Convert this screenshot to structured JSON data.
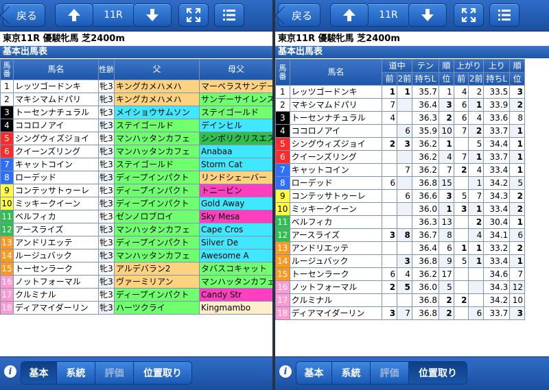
{
  "left": {
    "back_label": "戻る",
    "race_label": "11R",
    "race_title": "東京11R  優駿牝馬  芝2400m",
    "section_title": "基本出馬表",
    "headers": {
      "num": "馬番",
      "name": "馬名",
      "age": "性齢",
      "sire": "父",
      "dam_sire": "母父"
    },
    "rows": [
      {
        "num": "1",
        "name": "レッツゴードンキ",
        "age": "牝3",
        "sire": "キングカメハメハ",
        "dam_sire": "マーベラスサンデー",
        "frame": "#ffffff",
        "ftext": "#000000",
        "sire_color": "#ffd27f",
        "dam_color": "#ffd27f"
      },
      {
        "num": "2",
        "name": "マキシマムドパリ",
        "age": "牝3",
        "sire": "キングカメハメハ",
        "dam_sire": "サンデーサイレンス",
        "frame": "#ffffff",
        "ftext": "#000000",
        "sire_color": "#ffd27f",
        "dam_color": "#6fff6f"
      },
      {
        "num": "3",
        "name": "トーセンナチュラル",
        "age": "牝3",
        "sire": "メイショウサムソン",
        "dam_sire": "ステイゴールド",
        "frame": "#000000",
        "ftext": "#ffffff",
        "sire_color": "#3fe8ff",
        "dam_color": "#6fff6f"
      },
      {
        "num": "4",
        "name": "ココロノアイ",
        "age": "牝3",
        "sire": "ステイゴールド",
        "dam_sire": "デインヒル",
        "frame": "#000000",
        "ftext": "#ffffff",
        "sire_color": "#6fff6f",
        "dam_color": "#3fe8ff"
      },
      {
        "num": "5",
        "name": "シングウィズジョイ",
        "age": "牝3",
        "sire": "マンハッタンカフェ",
        "dam_sire": "シンボリクリスエス",
        "frame": "#ff2a2a",
        "ftext": "#ffffff",
        "sire_color": "#6fff6f",
        "dam_color": "#2fbf4f"
      },
      {
        "num": "6",
        "name": "クイーンズリング",
        "age": "牝3",
        "sire": "マンハッタンカフェ",
        "dam_sire": "Anabaa",
        "frame": "#ff2a2a",
        "ftext": "#ffffff",
        "sire_color": "#6fff6f",
        "dam_color": "#3fe8ff"
      },
      {
        "num": "7",
        "name": "キャットコイン",
        "age": "牝3",
        "sire": "ステイゴールド",
        "dam_sire": "Storm Cat",
        "frame": "#2f6fff",
        "ftext": "#ffffff",
        "sire_color": "#6fff6f",
        "dam_color": "#3fe8ff"
      },
      {
        "num": "8",
        "name": "ローデッド",
        "age": "牝3",
        "sire": "ディープインパクト",
        "dam_sire": "リンドシェーバー",
        "frame": "#2f6fff",
        "ftext": "#ffffff",
        "sire_color": "#6fff6f",
        "dam_color": "#ffd27f"
      },
      {
        "num": "9",
        "name": "コンテッサトゥーレ",
        "age": "牝3",
        "sire": "ディープインパクト",
        "dam_sire": "トニービン",
        "frame": "#ffff3f",
        "ftext": "#000000",
        "sire_color": "#6fff6f",
        "dam_color": "#ff3fbf"
      },
      {
        "num": "10",
        "name": "ミッキークイーン",
        "age": "牝3",
        "sire": "ディープインパクト",
        "dam_sire": "Gold Away",
        "frame": "#ffff3f",
        "ftext": "#000000",
        "sire_color": "#6fff6f",
        "dam_color": "#3fe8ff"
      },
      {
        "num": "11",
        "name": "ベルフィカ",
        "age": "牝3",
        "sire": "ゼンノロブロイ",
        "dam_sire": "Sky Mesa",
        "frame": "#2fbf4f",
        "ftext": "#ffffff",
        "sire_color": "#6fff6f",
        "dam_color": "#ff3fbf"
      },
      {
        "num": "12",
        "name": "アースライズ",
        "age": "牝3",
        "sire": "マンハッタンカフェ",
        "dam_sire": "Cape Cros",
        "frame": "#2fbf4f",
        "ftext": "#ffffff",
        "sire_color": "#6fff6f",
        "dam_color": "#3fe8ff"
      },
      {
        "num": "13",
        "name": "アンドリエッテ",
        "age": "牝3",
        "sire": "ディープインパクト",
        "dam_sire": "Silver De",
        "frame": "#ff9a1f",
        "ftext": "#ffffff",
        "sire_color": "#6fff6f",
        "dam_color": "#3fe8ff"
      },
      {
        "num": "14",
        "name": "ルージュバック",
        "age": "牝3",
        "sire": "マンハッタンカフェ",
        "dam_sire": "Awesome A",
        "frame": "#ff9a1f",
        "ftext": "#ffffff",
        "sire_color": "#6fff6f",
        "dam_color": "#3fe8ff"
      },
      {
        "num": "15",
        "name": "トーセンラーク",
        "age": "牝3",
        "sire": "アルデバラン2",
        "dam_sire": "タバスコキャット",
        "frame": "#ff9a1f",
        "ftext": "#ffffff",
        "sire_color": "#ffd27f",
        "dam_color": "#6fff6f"
      },
      {
        "num": "16",
        "name": "ノットフォーマル",
        "age": "牝3",
        "sire": "ヴァーミリアン",
        "dam_sire": "マンハッタンカフェ",
        "frame": "#ff9ad2",
        "ftext": "#ffffff",
        "sire_color": "#ffd27f",
        "dam_color": "#6fff6f"
      },
      {
        "num": "17",
        "name": "クルミナル",
        "age": "牝3",
        "sire": "ディープインパクト",
        "dam_sire": "Candy Str",
        "frame": "#ff9ad2",
        "ftext": "#ffffff",
        "sire_color": "#6fff6f",
        "dam_color": "#ff3fbf"
      },
      {
        "num": "18",
        "name": "ディアマイダーリン",
        "age": "牝3",
        "sire": "ハーツクライ",
        "dam_sire": "Kingmambo",
        "frame": "#ff9ad2",
        "ftext": "#ffffff",
        "sire_color": "#6fff6f",
        "dam_color": "#ffeecb"
      }
    ],
    "tabs": [
      "基本",
      "系統",
      "評価",
      "位置取り"
    ]
  },
  "right": {
    "back_label": "戻る",
    "race_label": "11R",
    "race_title": "東京11R  優駿牝馬  芝2400m",
    "section_title": "基本出馬表",
    "headers": {
      "num": "馬番",
      "name": "馬名",
      "douchu": "道中",
      "mae": "前",
      "mae2": "2前",
      "ten": "テン",
      "mochi": "持ちL",
      "juni": "順",
      "i": "位",
      "agari": "上がり",
      "agari_mae": "前",
      "agari_mae2": "2前",
      "nobori": "上り",
      "nobori_mochi": "持ちL",
      "junni2": "順",
      "i2": "位"
    },
    "rows": [
      {
        "num": "1",
        "name": "レッツゴードンキ",
        "d1": "1",
        "d2": "1",
        "ten": "35.7",
        "r1": "1",
        "a1": "4",
        "a2": "2",
        "up": "33.5",
        "r2": "3",
        "b": [
          1,
          1,
          0,
          0,
          0,
          0,
          0,
          1
        ]
      },
      {
        "num": "2",
        "name": "マキシマムドパリ",
        "d1": "7",
        "d2": "",
        "ten": "36.4",
        "r1": "3",
        "a1": "6",
        "a2": "1",
        "up": "33.9",
        "r2": "2",
        "b": [
          0,
          0,
          0,
          1,
          0,
          1,
          0,
          1
        ]
      },
      {
        "num": "3",
        "name": "トーセンナチュラル",
        "d1": "4",
        "d2": "",
        "ten": "36.3",
        "r1": "2",
        "a1": "6",
        "a2": "4",
        "up": "33.6",
        "r2": "8",
        "b": [
          0,
          0,
          0,
          1,
          0,
          0,
          0,
          0
        ]
      },
      {
        "num": "4",
        "name": "ココロノアイ",
        "d1": "",
        "d2": "6",
        "ten": "35.9",
        "r1": "10",
        "a1": "7",
        "a2": "2",
        "up": "33.7",
        "r2": "1",
        "b": [
          0,
          0,
          0,
          0,
          0,
          1,
          0,
          1
        ]
      },
      {
        "num": "5",
        "name": "シングウィズジョイ",
        "d1": "2",
        "d2": "3",
        "ten": "36.2",
        "r1": "1",
        "a1": "",
        "a2": "5",
        "up": "34.4",
        "r2": "1",
        "b": [
          1,
          1,
          0,
          1,
          0,
          0,
          0,
          1
        ]
      },
      {
        "num": "6",
        "name": "クイーンズリング",
        "d1": "",
        "d2": "",
        "ten": "36.2",
        "r1": "4",
        "a1": "7",
        "a2": "1",
        "up": "33.7",
        "r2": "1",
        "b": [
          0,
          0,
          0,
          0,
          0,
          1,
          0,
          1
        ]
      },
      {
        "num": "7",
        "name": "キャットコイン",
        "d1": "",
        "d2": "7",
        "ten": "36.2",
        "r1": "7",
        "a1": "2",
        "a2": "4",
        "up": "33.4",
        "r2": "1",
        "b": [
          0,
          0,
          0,
          0,
          1,
          0,
          0,
          1
        ]
      },
      {
        "num": "8",
        "name": "ローデッド",
        "d1": "6",
        "d2": "",
        "ten": "36.8",
        "r1": "15",
        "a1": "",
        "a2": "1",
        "up": "34.2",
        "r2": "5",
        "b": [
          0,
          0,
          0,
          0,
          0,
          0,
          0,
          0
        ]
      },
      {
        "num": "9",
        "name": "コンテッサトゥーレ",
        "d1": "",
        "d2": "6",
        "ten": "36.6",
        "r1": "3",
        "a1": "5",
        "a2": "7",
        "up": "34.3",
        "r2": "2",
        "b": [
          0,
          0,
          0,
          1,
          0,
          0,
          0,
          1
        ]
      },
      {
        "num": "10",
        "name": "ミッキークイーン",
        "d1": "",
        "d2": "",
        "ten": "36.0",
        "r1": "1",
        "a1": "3",
        "a2": "1",
        "up": "33.4",
        "r2": "2",
        "b": [
          0,
          0,
          0,
          1,
          1,
          1,
          0,
          1
        ]
      },
      {
        "num": "11",
        "name": "ベルフィカ",
        "d1": "",
        "d2": "",
        "ten": "36.3",
        "r1": "13",
        "a1": "",
        "a2": "2",
        "up": "30.4",
        "r2": "1",
        "b": [
          0,
          0,
          0,
          0,
          0,
          1,
          0,
          1
        ]
      },
      {
        "num": "12",
        "name": "アースライズ",
        "d1": "3",
        "d2": "8",
        "ten": "36.7",
        "r1": "8",
        "a1": "",
        "a2": "4",
        "up": "34.1",
        "r2": "6",
        "b": [
          1,
          1,
          0,
          0,
          0,
          0,
          0,
          0
        ]
      },
      {
        "num": "13",
        "name": "アンドリエッテ",
        "d1": "",
        "d2": "",
        "ten": "36.4",
        "r1": "6",
        "a1": "1",
        "a2": "1",
        "up": "33.2",
        "r2": "2",
        "b": [
          0,
          0,
          0,
          0,
          1,
          1,
          0,
          1
        ]
      },
      {
        "num": "14",
        "name": "ルージュバック",
        "d1": "",
        "d2": "3",
        "ten": "36.8",
        "r1": "9",
        "a1": "5",
        "a2": "1",
        "up": "33.4",
        "r2": "1",
        "b": [
          0,
          1,
          0,
          0,
          0,
          1,
          0,
          1
        ]
      },
      {
        "num": "15",
        "name": "トーセンラーク",
        "d1": "6",
        "d2": "4",
        "ten": "36.2",
        "r1": "17",
        "a1": "",
        "a2": "",
        "up": "34.6",
        "r2": "7",
        "b": [
          0,
          0,
          0,
          0,
          0,
          0,
          0,
          0
        ]
      },
      {
        "num": "16",
        "name": "ノットフォーマル",
        "d1": "2",
        "d2": "5",
        "ten": "36.0",
        "r1": "5",
        "a1": "",
        "a2": "",
        "up": "34.3",
        "r2": "12",
        "b": [
          1,
          1,
          0,
          0,
          0,
          0,
          0,
          0
        ]
      },
      {
        "num": "17",
        "name": "クルミナル",
        "d1": "",
        "d2": "",
        "ten": "36.8",
        "r1": "2",
        "a1": "2",
        "a2": "",
        "up": "34.2",
        "r2": "10",
        "b": [
          0,
          0,
          0,
          1,
          1,
          0,
          0,
          0
        ]
      },
      {
        "num": "18",
        "name": "ディアマイダーリン",
        "d1": "3",
        "d2": "7",
        "ten": "36.8",
        "r1": "2",
        "a1": "",
        "a2": "6",
        "up": "33.7",
        "r2": "3",
        "b": [
          1,
          0,
          0,
          1,
          0,
          0,
          0,
          1
        ]
      }
    ],
    "frames": [
      "#ffffff",
      "#ffffff",
      "#000000",
      "#000000",
      "#ff2a2a",
      "#ff2a2a",
      "#2f6fff",
      "#2f6fff",
      "#ffff3f",
      "#ffff3f",
      "#2fbf4f",
      "#2fbf4f",
      "#ff9a1f",
      "#ff9a1f",
      "#ff9a1f",
      "#ff9ad2",
      "#ff9ad2",
      "#ff9ad2"
    ],
    "ftexts": [
      "#000000",
      "#000000",
      "#ffffff",
      "#ffffff",
      "#ffffff",
      "#ffffff",
      "#ffffff",
      "#ffffff",
      "#000000",
      "#000000",
      "#ffffff",
      "#ffffff",
      "#ffffff",
      "#ffffff",
      "#ffffff",
      "#ffffff",
      "#ffffff",
      "#ffffff"
    ],
    "tabs": [
      "基本",
      "系統",
      "評価",
      "位置取り"
    ]
  }
}
